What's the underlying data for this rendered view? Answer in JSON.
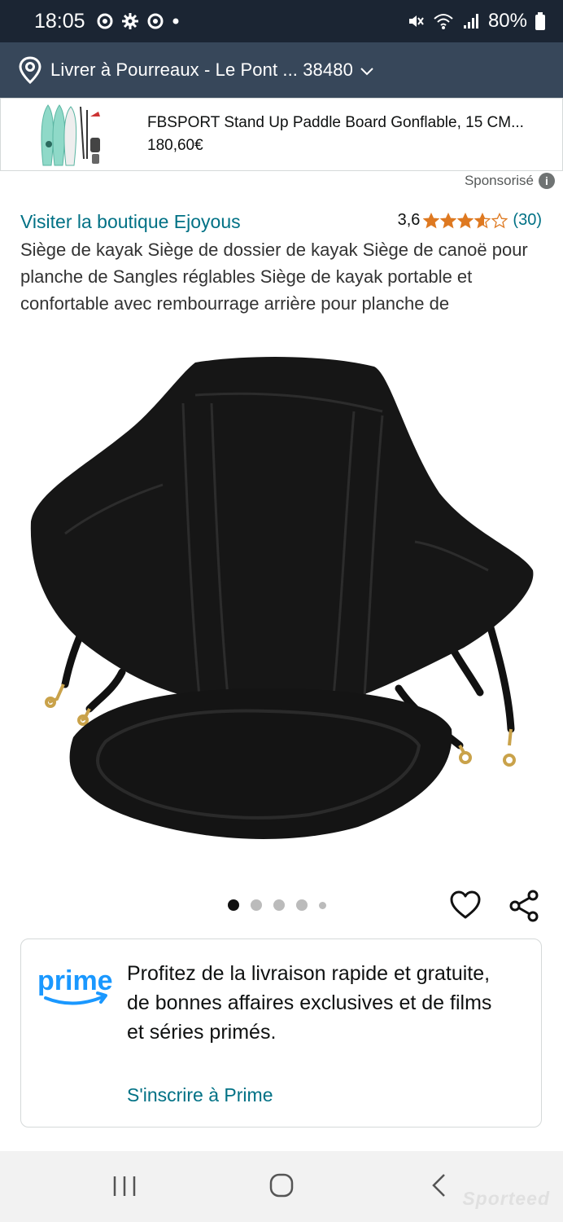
{
  "status_bar": {
    "time": "18:05",
    "left_icons": [
      "chrome-icon",
      "gear-icon",
      "chrome-icon",
      "dot-icon"
    ],
    "right_icons": [
      "mute-icon",
      "wifi-icon",
      "signal-icon"
    ],
    "battery": "80%"
  },
  "location_bar": {
    "text": "Livrer à Pourreaux - Le Pont ... 38480",
    "icon": "location-pin-icon"
  },
  "sponsored_product": {
    "title": "FBSPORT Stand Up Paddle Board Gonflable, 15 CM...",
    "price": "180,60€",
    "sponsored_label": "Sponsorisé"
  },
  "product": {
    "store_link": "Visiter la boutique Ejoyous",
    "rating_value": "3,6",
    "rating_stars": 3.6,
    "rating_count": "(30)",
    "title": "Siège de kayak Siège de dossier de kayak Siège de canoë pour planche de Sangles réglables Siège de kayak portable et confortable avec rembourrage arrière pour planche de",
    "image_count": 5,
    "active_image": 0
  },
  "prime": {
    "logo_text": "prime",
    "message": "Profitez de la livraison rapide et gratuite, de bonnes affaires exclusives et de films et séries primés.",
    "link": "S'inscrire à Prime"
  },
  "watermark": "Sporteed",
  "colors": {
    "status_bar": "#1b2533",
    "location_bar": "#37475a",
    "link": "#007185",
    "star": "#de7921",
    "prime_blue": "#1a98ff"
  }
}
